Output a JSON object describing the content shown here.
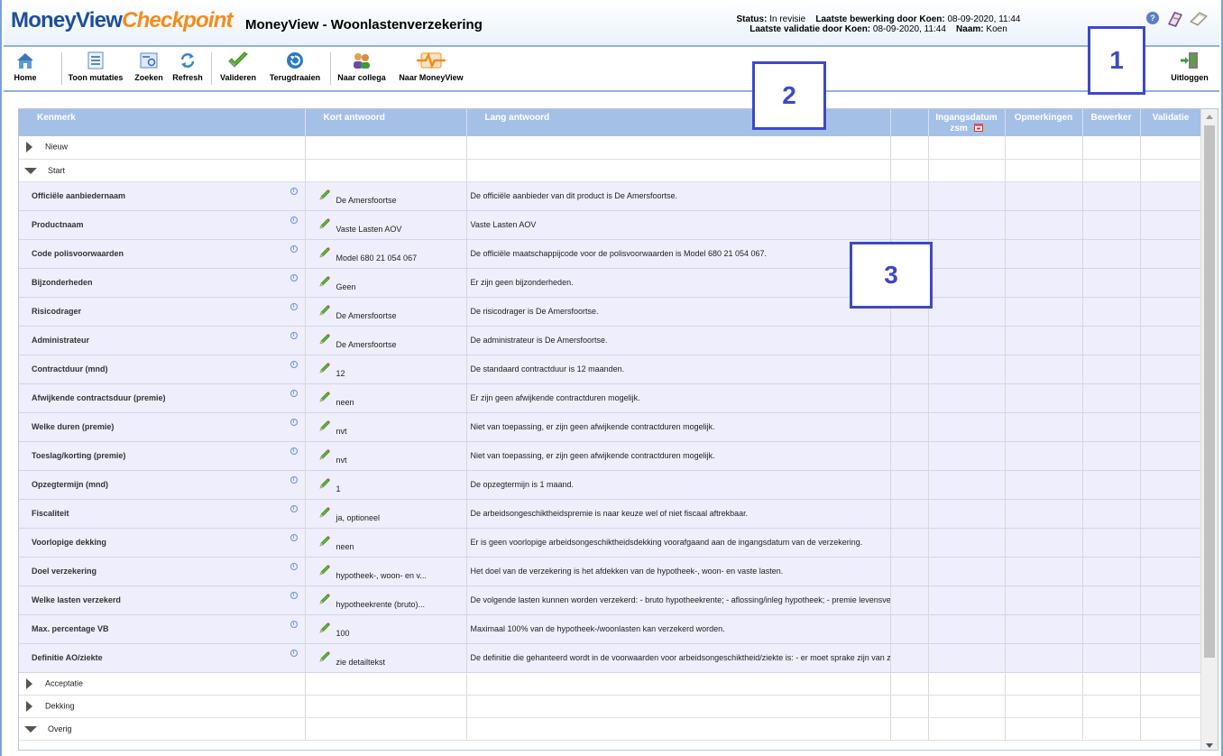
{
  "header": {
    "logo_part1": "MoneyView",
    "logo_part2": "Checkpoint",
    "title": "MoneyView - Woonlastenverzekering",
    "status_label": "Status:",
    "status_value": "In revisie",
    "last_edit_label": "Laatste bewerking door Koen:",
    "last_edit_value": "08-09-2020, 11:44",
    "last_validation_label": "Laatste validatie door Koen:",
    "last_validation_value": "08-09-2020, 11:44",
    "name_label": "Naam:",
    "name_value": "Koen",
    "help_icon": "?"
  },
  "toolbar": {
    "home": "Home",
    "toon_mutaties": "Toon mutaties",
    "zoeken": "Zoeken",
    "refresh": "Refresh",
    "valideren": "Valideren",
    "terugdraaien": "Terugdraaien",
    "naar_collega": "Naar collega",
    "naar_moneyview": "Naar MoneyView",
    "uitloggen": "Uitloggen"
  },
  "callouts": [
    "1",
    "2",
    "3"
  ],
  "grid": {
    "columns": {
      "kenmerk": "Kenmerk",
      "kort": "Kort antwoord",
      "lang": "Lang antwoord",
      "ingang": "Ingangsdatum",
      "ingang_sub": "zsm",
      "opmerkingen": "Opmerkingen",
      "bewerker": "Bewerker",
      "validatie": "Validatie"
    },
    "groups_top": [
      {
        "label": "Nieuw",
        "expanded": false
      },
      {
        "label": "Start",
        "expanded": true
      }
    ],
    "rows": [
      {
        "kenmerk": "Officiële aanbiedernaam",
        "kort": "De Amersfoortse",
        "lang": "De officiële aanbieder van dit product is De Amersfoortse."
      },
      {
        "kenmerk": "Productnaam",
        "kort": "Vaste Lasten AOV",
        "lang": "Vaste Lasten AOV"
      },
      {
        "kenmerk": "Code polisvoorwaarden",
        "kort": "Model 680 21 054 067",
        "lang": "De officiële maatschappijcode voor de polisvoorwaarden is Model 680 21 054 067."
      },
      {
        "kenmerk": "Bijzonderheden",
        "kort": "Geen",
        "lang": "Er zijn geen bijzonderheden."
      },
      {
        "kenmerk": "Risicodrager",
        "kort": "De Amersfoortse",
        "lang": "De risicodrager is De Amersfoortse."
      },
      {
        "kenmerk": "Administrateur",
        "kort": "De Amersfoortse",
        "lang": "De administrateur is De Amersfoortse."
      },
      {
        "kenmerk": "Contractduur (mnd)",
        "kort": "12",
        "lang": "De standaard contractduur is 12 maanden."
      },
      {
        "kenmerk": "Afwijkende contractsduur (premie)",
        "kort": "neen",
        "lang": "Er zijn geen afwijkende contractduren mogelijk."
      },
      {
        "kenmerk": "Welke duren (premie)",
        "kort": "nvt",
        "lang": "Niet van toepassing, er zijn geen afwijkende contractduren mogelijk."
      },
      {
        "kenmerk": "Toeslag/korting (premie)",
        "kort": "nvt",
        "lang": "Niet van toepassing, er zijn geen afwijkende contractduren mogelijk."
      },
      {
        "kenmerk": "Opzegtermijn (mnd)",
        "kort": "1",
        "lang": "De opzegtermijn is 1 maand."
      },
      {
        "kenmerk": "Fiscaliteit",
        "kort": "ja, optioneel",
        "lang": "De arbeidsongeschiktheidspremie is naar keuze wel of niet fiscaal aftrekbaar."
      },
      {
        "kenmerk": "Voorlopige dekking",
        "kort": "neen",
        "lang": "Er is geen voorlopige arbeidsongeschiktheidsdekking voorafgaand aan de ingangsdatum van de verzekering."
      },
      {
        "kenmerk": "Doel verzekering",
        "kort": "hypotheek-, woon- en v...",
        "lang": "Het doel van de verzekering is het afdekken van de hypotheek-, woon- en vaste lasten."
      },
      {
        "kenmerk": "Welke lasten verzekerd",
        "kort": "hypotheekrente (bruto)...",
        "lang": "De volgende lasten kunnen worden verzekerd: - bruto hypotheekrente; - aflossing/inleg hypotheek; - premie levensverzekering"
      },
      {
        "kenmerk": "Max. percentage VB",
        "kort": "100",
        "lang": "Maximaal 100% van de hypotheek-/woonlasten kan verzekerd worden."
      },
      {
        "kenmerk": "Definitie AO/ziekte",
        "kort": "zie detailtekst",
        "lang": "De definitie die gehanteerd wordt in de voorwaarden voor arbeidsongeschiktheid/ziekte is: - er moet sprake zijn van ziekte"
      }
    ],
    "groups_bottom": [
      {
        "label": "Acceptatie",
        "expanded": false
      },
      {
        "label": "Dekking",
        "expanded": false
      },
      {
        "label": "Overig",
        "expanded": true
      }
    ]
  }
}
